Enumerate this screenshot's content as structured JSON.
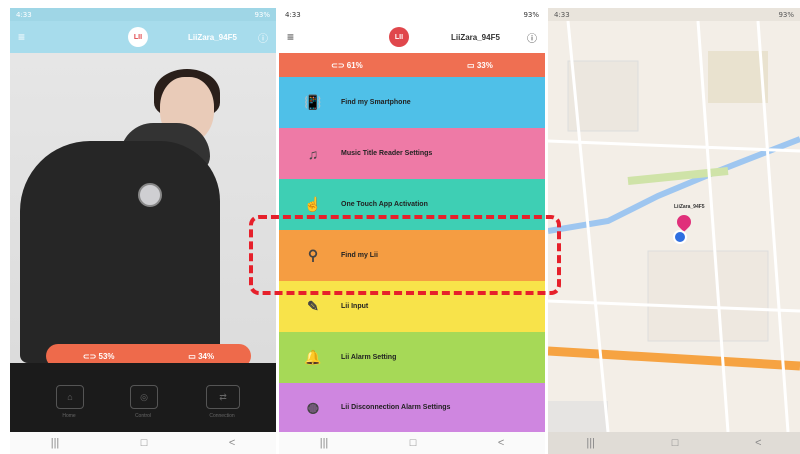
{
  "colors": {
    "appbar_blue": "#a7dcec",
    "battery_orange": "#ef6f52",
    "highlight_red": "#e6202b",
    "menu": [
      "#4fc0e8",
      "#ee7aa6",
      "#3ecfb4",
      "#f59d42",
      "#f8e34a",
      "#a6d957",
      "#cf86e0"
    ]
  },
  "phone1": {
    "status_left": "4:33",
    "status_right": "93%",
    "logo": "LII",
    "device_name": "LiiZara_94F5",
    "battery_left": "53%",
    "battery_right": "34%",
    "tabs": [
      {
        "icon": "home-icon",
        "label": "Home"
      },
      {
        "icon": "control-icon",
        "label": "Control"
      },
      {
        "icon": "connection-icon",
        "label": "Connection"
      }
    ],
    "nav": [
      "|||",
      "□",
      "<"
    ]
  },
  "phone2": {
    "status_left": "4:33",
    "status_right": "93%",
    "logo": "LII",
    "device_name": "LiiZara_94F5",
    "battery_left": "61%",
    "battery_right": "33%",
    "menu": [
      {
        "label": "Find my Smartphone",
        "icon": "phone-vibrate-icon"
      },
      {
        "label": "Music Title Reader Settings",
        "icon": "music-icon"
      },
      {
        "label": "One Touch App Activation",
        "icon": "touch-icon"
      },
      {
        "label": "Find my Lii",
        "icon": "search-icon"
      },
      {
        "label": "Lii Input",
        "icon": "input-icon"
      },
      {
        "label": "Lii Alarm Setting",
        "icon": "bell-icon"
      },
      {
        "label": "Lii Disconnection Alarm Settings",
        "icon": "fingerprint-icon"
      }
    ],
    "nav": [
      "|||",
      "□",
      "<"
    ]
  },
  "phone3": {
    "status_left": "4:33",
    "status_right": "93%",
    "pin_label": "LiiZara_94F5",
    "nav": [
      "|||",
      "□",
      "<"
    ]
  }
}
